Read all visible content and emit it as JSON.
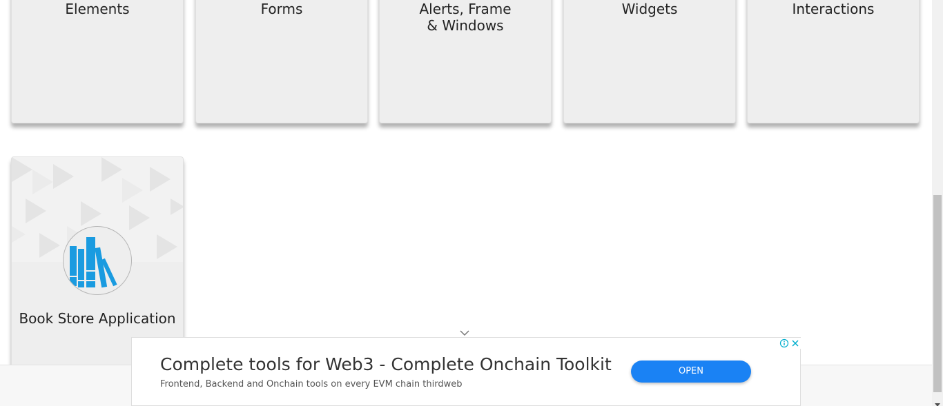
{
  "cards": [
    {
      "title": "Elements"
    },
    {
      "title": "Forms"
    },
    {
      "title": "Alerts, Frame & Windows"
    },
    {
      "title": "Widgets"
    },
    {
      "title": "Interactions"
    },
    {
      "title": "Book Store Application"
    }
  ],
  "ad": {
    "title": "Complete tools for Web3 - Complete Onchain Toolkit",
    "description": "Frontend, Backend and Onchain tools on every EVM chain thirdweb",
    "button_label": "OPEN",
    "accent_color": "#1a82f4",
    "info_icon": "info-icon",
    "close_icon": "close-icon"
  },
  "icons": {
    "card_icon": "books-icon",
    "chevron": "chevron-down-icon"
  }
}
